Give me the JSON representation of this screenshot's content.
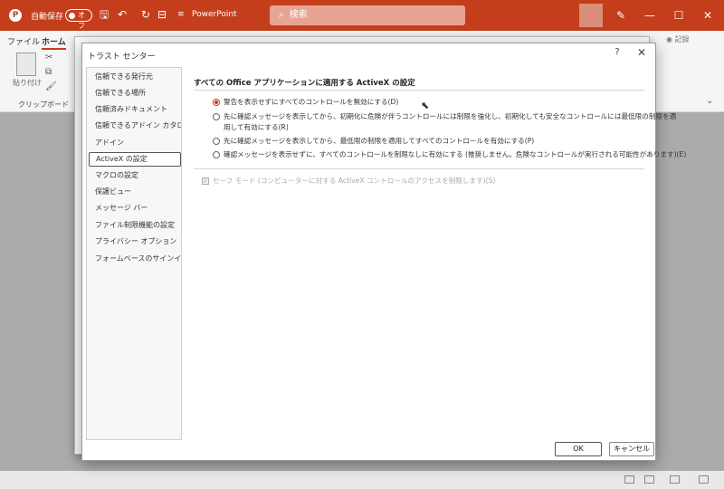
{
  "titlebar": {
    "logo": "P",
    "autosave_label": "自動保存",
    "autosave_state": "オフ",
    "app_name": "PowerPoint",
    "search_placeholder": "検索",
    "bg_color": "#c43e1c"
  },
  "ribbon": {
    "tabs": [
      "ファイル",
      "ホーム"
    ],
    "paste_label": "貼り付け",
    "clipboard_group": "クリップボード",
    "record_label": "◉ 記録"
  },
  "dialog": {
    "title": "トラスト センター",
    "help": "?",
    "close": "✕",
    "nav_items": [
      "信頼できる発行元",
      "信頼できる場所",
      "信頼済みドキュメント",
      "信頼できるアドイン カタログ",
      "アドイン",
      "ActiveX の設定",
      "マクロの設定",
      "保護ビュー",
      "メッセージ バー",
      "ファイル制限機能の設定",
      "プライバシー オプション",
      "フォームベースのサインイン"
    ],
    "selected_nav_index": 5,
    "section_title": "すべての Office アプリケーションに適用する ActiveX の設定",
    "options": [
      "警告を表示せずにすべてのコントロールを無効にする(D)",
      "先に確認メッセージを表示してから、初期化に危険が伴うコントロールには制限を強化し、初期化しても安全なコントロールには最低限の制限を適",
      "用して有効にする(R)",
      "先に確認メッセージを表示してから、最低限の制限を適用してすべてのコントロールを有効にする(P)",
      "確認メッセージを表示せずに、すべてのコントロールを制限なしに有効にする (推奨しません。危険なコントロールが実行される可能性があります)(E)"
    ],
    "selected_option": 0,
    "safe_mode_label": "セーフ モード (コンピューターに対する ActiveX コントロールのアクセスを制限します)(S)",
    "ok_label": "OK",
    "cancel_label": "キャンセル"
  }
}
